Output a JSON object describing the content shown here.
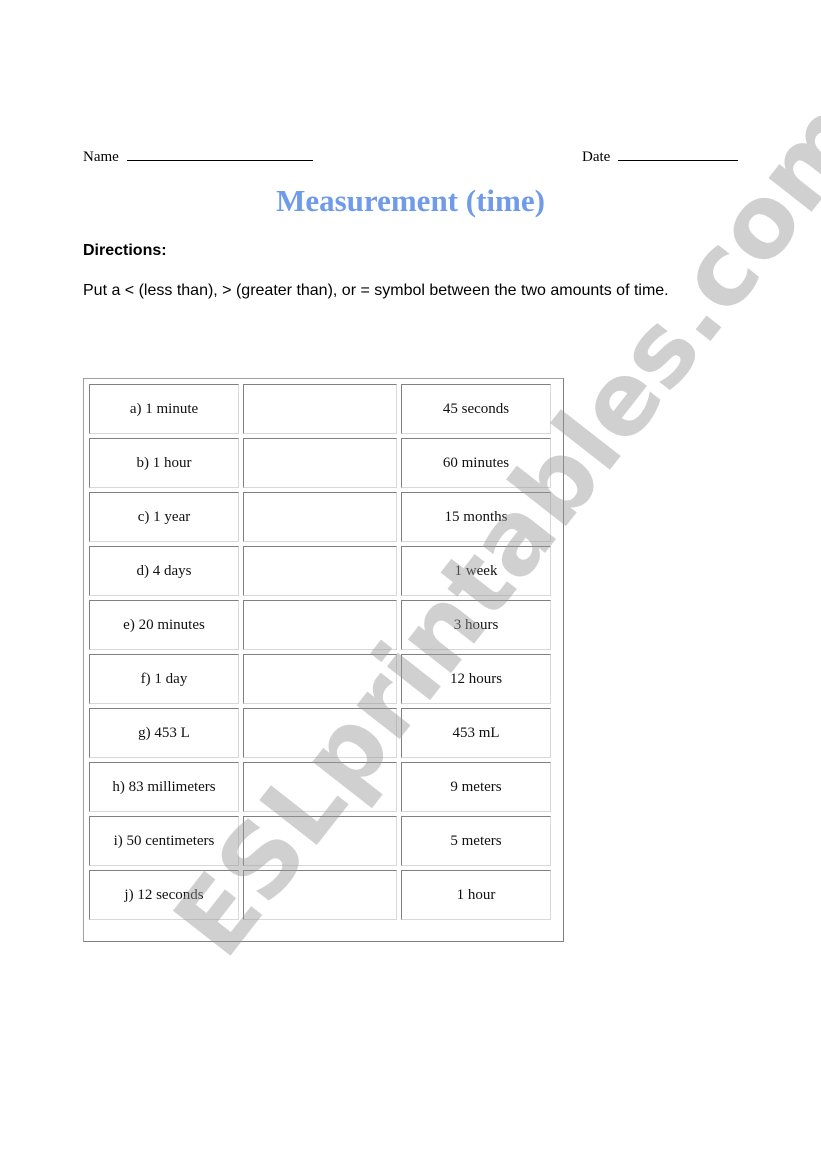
{
  "header": {
    "name_label": "Name",
    "date_label": "Date"
  },
  "title": "Measurement (time)",
  "directions": {
    "heading": "Directions:",
    "text": "Put a < (less than), > (greater than), or = symbol between the two amounts of time."
  },
  "table": {
    "rows": [
      {
        "left": "a) 1 minute",
        "answer": "",
        "right": "45 seconds"
      },
      {
        "left": "b) 1 hour",
        "answer": "",
        "right": "60 minutes"
      },
      {
        "left": "c) 1 year",
        "answer": "",
        "right": "15 months"
      },
      {
        "left": "d) 4 days",
        "answer": "",
        "right": "1 week"
      },
      {
        "left": "e) 20 minutes",
        "answer": "",
        "right": "3 hours"
      },
      {
        "left": "f) 1 day",
        "answer": "",
        "right": "12 hours"
      },
      {
        "left": "g) 453 L",
        "answer": "",
        "right": "453 mL"
      },
      {
        "left": "h) 83 millimeters",
        "answer": "",
        "right": "9 meters"
      },
      {
        "left": "i) 50 centimeters",
        "answer": "",
        "right": "5 meters"
      },
      {
        "left": "j) 12 seconds",
        "answer": "",
        "right": "1 hour"
      }
    ]
  },
  "watermark": "ESLprintables.com",
  "colors": {
    "title": "#6f9be8",
    "watermark": "#969696"
  }
}
